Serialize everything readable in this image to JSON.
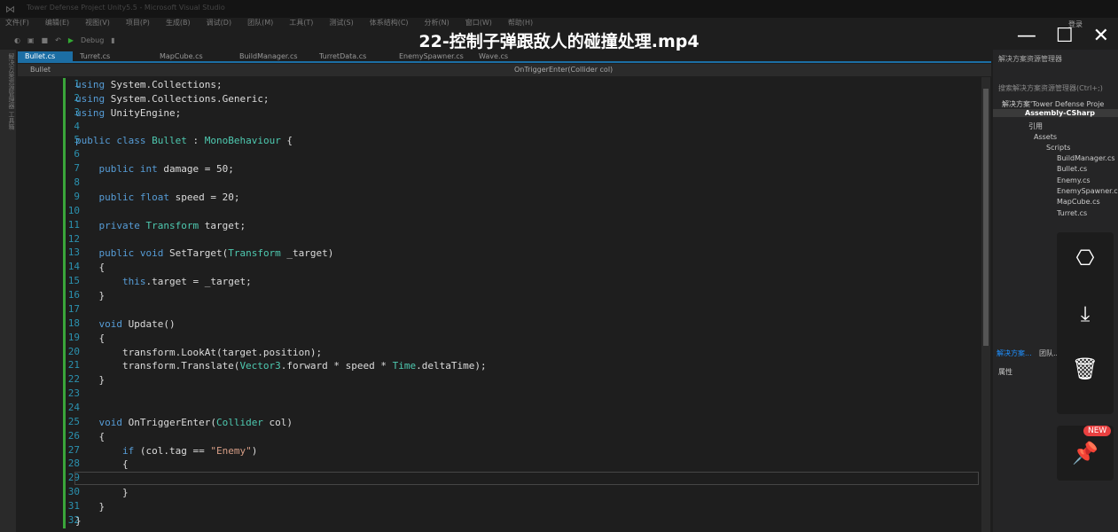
{
  "window": {
    "app_title": "Tower Defense Project Unity5.5 - Microsoft Visual Studio",
    "video_title": "22-控制子弹跟敌人的碰撞处理.mp4",
    "controls": {
      "minimize": "—",
      "maximize": "☐",
      "close": "✕"
    }
  },
  "menu": [
    "文件(F)",
    "编辑(E)",
    "视图(V)",
    "项目(P)",
    "生成(B)",
    "调试(D)",
    "团队(M)",
    "工具(T)",
    "测试(S)",
    "体系结构(C)",
    "分析(N)",
    "窗口(W)",
    "帮助(H)"
  ],
  "toolbar": {
    "config": "Debug"
  },
  "left_strip": "解决方案资源管理器 工具箱",
  "tabs": [
    "Bullet.cs",
    "Turret.cs",
    "MapCube.cs",
    "BuildManager.cs",
    "TurretData.cs",
    "EnemySpawner.cs",
    "Wave.cs"
  ],
  "navbar": {
    "class": "Bullet",
    "member": "OnTriggerEnter(Collider col)"
  },
  "code": [
    [
      [
        "using ",
        "kw"
      ],
      [
        "System.Collections;",
        "tx"
      ]
    ],
    [
      [
        "using ",
        "kw"
      ],
      [
        "System.Collections.Generic;",
        "tx"
      ]
    ],
    [
      [
        "using ",
        "kw"
      ],
      [
        "UnityEngine;",
        "tx"
      ]
    ],
    [],
    [
      [
        "public class ",
        "kw"
      ],
      [
        "Bullet",
        "ty"
      ],
      [
        " : ",
        "tx"
      ],
      [
        "MonoBehaviour",
        "ty"
      ],
      [
        " {",
        "tx"
      ]
    ],
    [],
    [
      [
        "    public int ",
        "kw"
      ],
      [
        "damage = 50;",
        "tx"
      ]
    ],
    [],
    [
      [
        "    public float ",
        "kw"
      ],
      [
        "speed = 20;",
        "tx"
      ]
    ],
    [],
    [
      [
        "    private ",
        "kw"
      ],
      [
        "Transform",
        "ty"
      ],
      [
        " target;",
        "tx"
      ]
    ],
    [],
    [
      [
        "    public void ",
        "kw"
      ],
      [
        "SetTarget(",
        "tx"
      ],
      [
        "Transform",
        "ty"
      ],
      [
        " _target)",
        "tx"
      ]
    ],
    [
      [
        "    {",
        "tx"
      ]
    ],
    [
      [
        "        this",
        "kw"
      ],
      [
        ".target = _target;",
        "tx"
      ]
    ],
    [
      [
        "    }",
        "tx"
      ]
    ],
    [],
    [
      [
        "    void ",
        "kw"
      ],
      [
        "Update()",
        "tx"
      ]
    ],
    [
      [
        "    {",
        "tx"
      ]
    ],
    [
      [
        "        transform.LookAt(target.position);",
        "tx"
      ]
    ],
    [
      [
        "        transform.Translate(",
        "tx"
      ],
      [
        "Vector3",
        "ty"
      ],
      [
        ".forward * speed * ",
        "tx"
      ],
      [
        "Time",
        "ty"
      ],
      [
        ".deltaTime);",
        "tx"
      ]
    ],
    [
      [
        "    }",
        "tx"
      ]
    ],
    [],
    [],
    [
      [
        "    void ",
        "kw"
      ],
      [
        "OnTriggerEnter(",
        "tx"
      ],
      [
        "Collider",
        "ty"
      ],
      [
        " col)",
        "tx"
      ]
    ],
    [
      [
        "    {",
        "tx"
      ]
    ],
    [
      [
        "        if ",
        "kw"
      ],
      [
        "(col.tag == ",
        "tx"
      ],
      [
        "\"Enemy\"",
        "st"
      ],
      [
        ")",
        "tx"
      ]
    ],
    [
      [
        "        {",
        "tx"
      ]
    ],
    [],
    [
      [
        "        }",
        "tx"
      ]
    ],
    [
      [
        "    }",
        "tx"
      ]
    ],
    [
      [
        "}",
        "tx"
      ]
    ]
  ],
  "solution_explorer": {
    "title": "解决方案资源管理器",
    "search_placeholder": "搜索解决方案资源管理器(Ctrl+;)",
    "solution": "解决方案'Tower Defense Proje",
    "project": "Assembly-CSharp",
    "references": "引用",
    "assets": "Assets",
    "scripts": "Scripts",
    "files": [
      "BuildManager.cs",
      "Bullet.cs",
      "Enemy.cs",
      "EnemySpawner.cs",
      "MapCube.cs",
      "Turret.cs"
    ],
    "bottom_tabs": [
      "解决方案...",
      "团队..."
    ],
    "properties": "属性",
    "login": "登录"
  },
  "overlay": {
    "new_badge": "NEW"
  }
}
